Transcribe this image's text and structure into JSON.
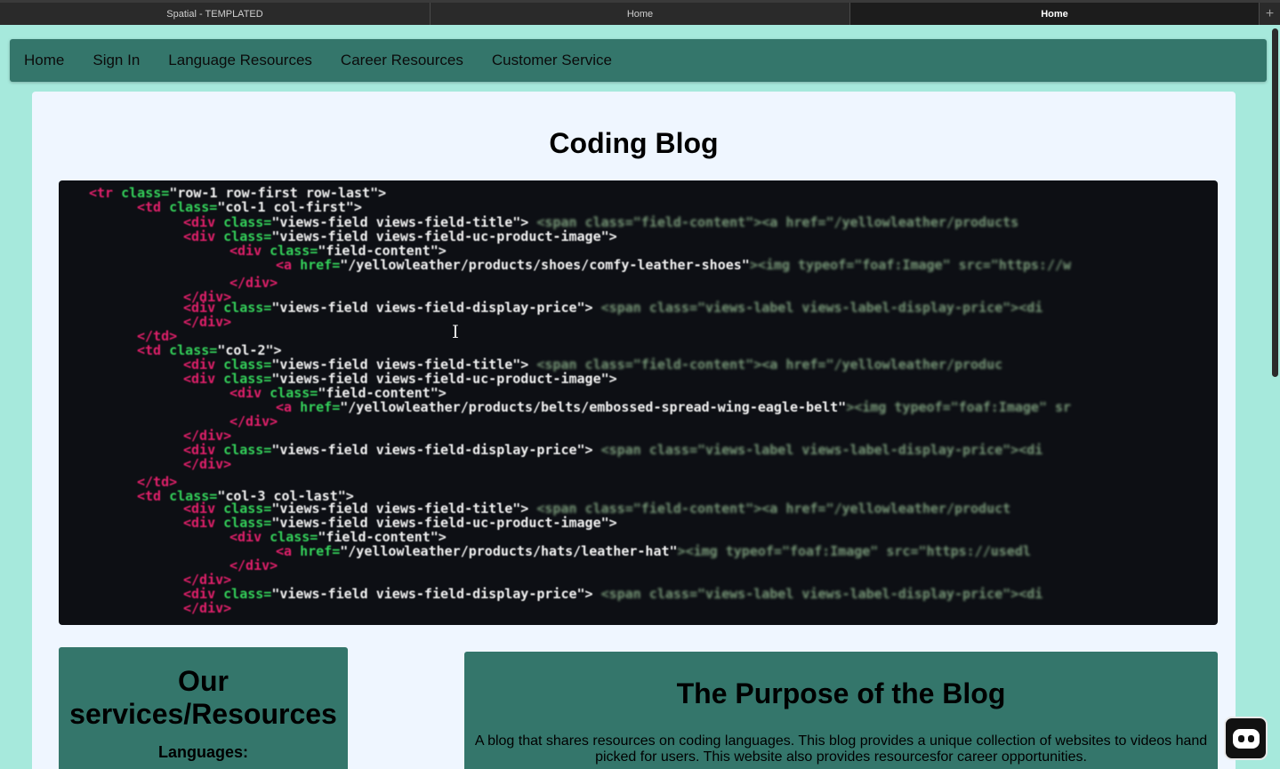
{
  "browser": {
    "tabs": [
      {
        "label": "Spatial - TEMPLATED"
      },
      {
        "label": "Home"
      },
      {
        "label": "Home"
      }
    ],
    "new_tab_icon": "+"
  },
  "nav": {
    "items": [
      {
        "label": "Home"
      },
      {
        "label": "Sign In"
      },
      {
        "label": "Language Resources"
      },
      {
        "label": "Career Resources"
      },
      {
        "label": "Customer Service"
      }
    ]
  },
  "main": {
    "title": "Coding Blog",
    "hero": {
      "code_lines": [
        {
          "k": "<tr",
          "a": " class=",
          "s": "\"row-1 row-first row-last\">"
        },
        {
          "k": "<td",
          "a": " class=",
          "s": "\"col-1 col-first\">"
        },
        {
          "k": "<div",
          "a": " class=",
          "s": "\"views-field views-field-title\">",
          "f": " <span class=\"field-content\"><a href=\"/yellowleather/products"
        },
        {
          "k": "<div",
          "a": " class=",
          "s": "\"views-field views-field-uc-product-image\">"
        },
        {
          "k": "<div",
          "a": " class=",
          "s": "\"field-content\">"
        },
        {
          "k": "<a",
          "a": " href=",
          "s": "\"/yellowleather/products/shoes/comfy-leather-shoes\"",
          "f": "><img typeof=\"foaf:Image\" src=\"https://w"
        },
        {
          "k": "</div>",
          "a": "",
          "s": ""
        },
        {
          "k": "</div>",
          "a": "",
          "s": ""
        },
        {
          "k": "<div",
          "a": " class=",
          "s": "\"views-field views-field-display-price\">",
          "f": " <span class=\"views-label views-label-display-price\"><di"
        },
        {
          "k": "</div>",
          "a": "",
          "s": ""
        },
        {
          "k": "</td>",
          "a": "",
          "s": ""
        },
        {
          "k": "<td",
          "a": " class=",
          "s": "\"col-2\">"
        },
        {
          "k": "<div",
          "a": " class=",
          "s": "\"views-field views-field-title\">",
          "f": " <span class=\"field-content\"><a href=\"/yellowleather/produc"
        },
        {
          "k": "<div",
          "a": " class=",
          "s": "\"views-field views-field-uc-product-image\">"
        },
        {
          "k": "<div",
          "a": " class=",
          "s": "\"field-content\">"
        },
        {
          "k": "<a",
          "a": " href=",
          "s": "\"/yellowleather/products/belts/embossed-spread-wing-eagle-belt\"",
          "f": "><img typeof=\"foaf:Image\" sr"
        },
        {
          "k": "</div>",
          "a": "",
          "s": ""
        },
        {
          "k": "</div>",
          "a": "",
          "s": ""
        },
        {
          "k": "<div",
          "a": " class=",
          "s": "\"views-field views-field-display-price\">",
          "f": " <span class=\"views-label views-label-display-price\"><di"
        },
        {
          "k": "</div>",
          "a": "",
          "s": ""
        },
        {
          "k": "</td>",
          "a": "",
          "s": ""
        },
        {
          "k": "<td",
          "a": " class=",
          "s": "\"col-3 col-last\">"
        },
        {
          "k": "<div",
          "a": " class=",
          "s": "\"views-field views-field-title\">",
          "f": " <span class=\"field-content\"><a href=\"/yellowleather/product"
        },
        {
          "k": "<div",
          "a": " class=",
          "s": "\"views-field views-field-uc-product-image\">"
        },
        {
          "k": "<div",
          "a": " class=",
          "s": "\"field-content\">"
        },
        {
          "k": "<a",
          "a": " href=",
          "s": "\"/yellowleather/products/hats/leather-hat\"",
          "f": "><img typeof=\"foaf:Image\" src=\"https://usedl"
        },
        {
          "k": "</div>",
          "a": "",
          "s": ""
        },
        {
          "k": "</div>",
          "a": "",
          "s": ""
        },
        {
          "k": "<div",
          "a": " class=",
          "s": "\"views-field views-field-display-price\">",
          "f": " <span class=\"views-label views-label-display-price\"><di"
        },
        {
          "k": "</div>",
          "a": "",
          "s": ""
        }
      ]
    },
    "services": {
      "title": "Our services/Resources",
      "subtitle": "Languages:"
    },
    "purpose": {
      "title": "The Purpose of the Blog",
      "text": "A blog that shares resources on coding languages. This blog provides a unique collection of websites to videos hand picked for users. This website also provides resourcesfor career opportunities."
    }
  },
  "colors": {
    "page_bg": "#a6e9dc",
    "nav_bg": "#34766b",
    "card_bg": "#eff6ff",
    "code_tag": "#e0206a",
    "code_attr": "#34d05a"
  },
  "icons": {
    "text_cursor": "text-cursor-icon",
    "assistant": "robot-assistant-icon"
  }
}
